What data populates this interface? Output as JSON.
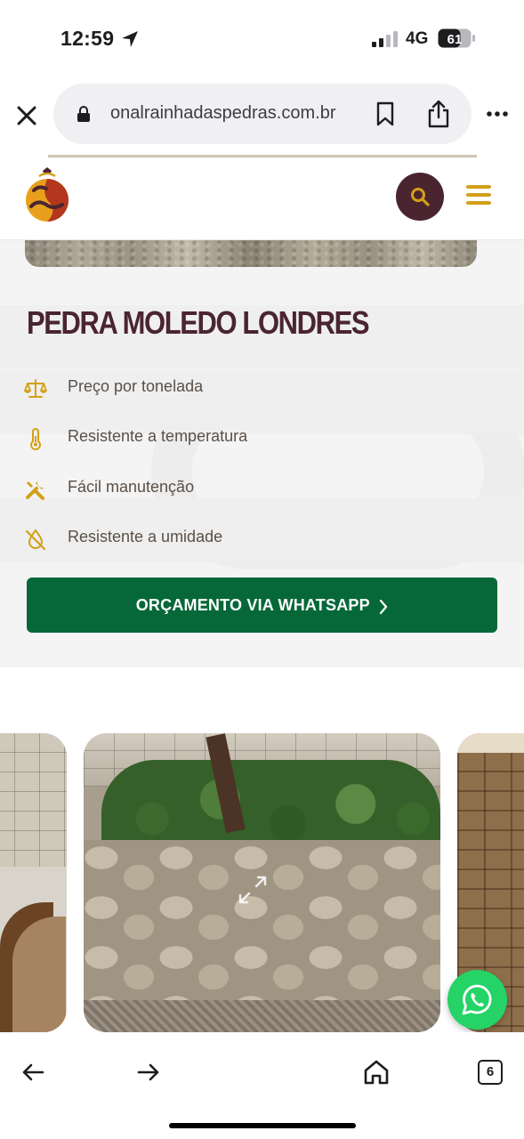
{
  "status_bar": {
    "time": "12:59",
    "network": "4G",
    "battery": "61"
  },
  "browser": {
    "url": "onalrainhadaspedras.com.br",
    "tab_count": "6"
  },
  "product": {
    "title": "PEDRA MOLEDO LONDRES",
    "features": [
      {
        "icon": "scale-icon",
        "label": "Preço por tonelada"
      },
      {
        "icon": "thermometer-icon",
        "label": "Resistente a temperatura"
      },
      {
        "icon": "tools-icon",
        "label": "Fácil manutenção"
      },
      {
        "icon": "no-water-icon",
        "label": "Resistente a umidade"
      }
    ],
    "cta_label": "ORÇAMENTO VIA WHATSAPP"
  },
  "colors": {
    "brand_dark": "#4a2530",
    "brand_gold": "#d4a017",
    "cta_green": "#066838",
    "whatsapp_green": "#25d366"
  }
}
